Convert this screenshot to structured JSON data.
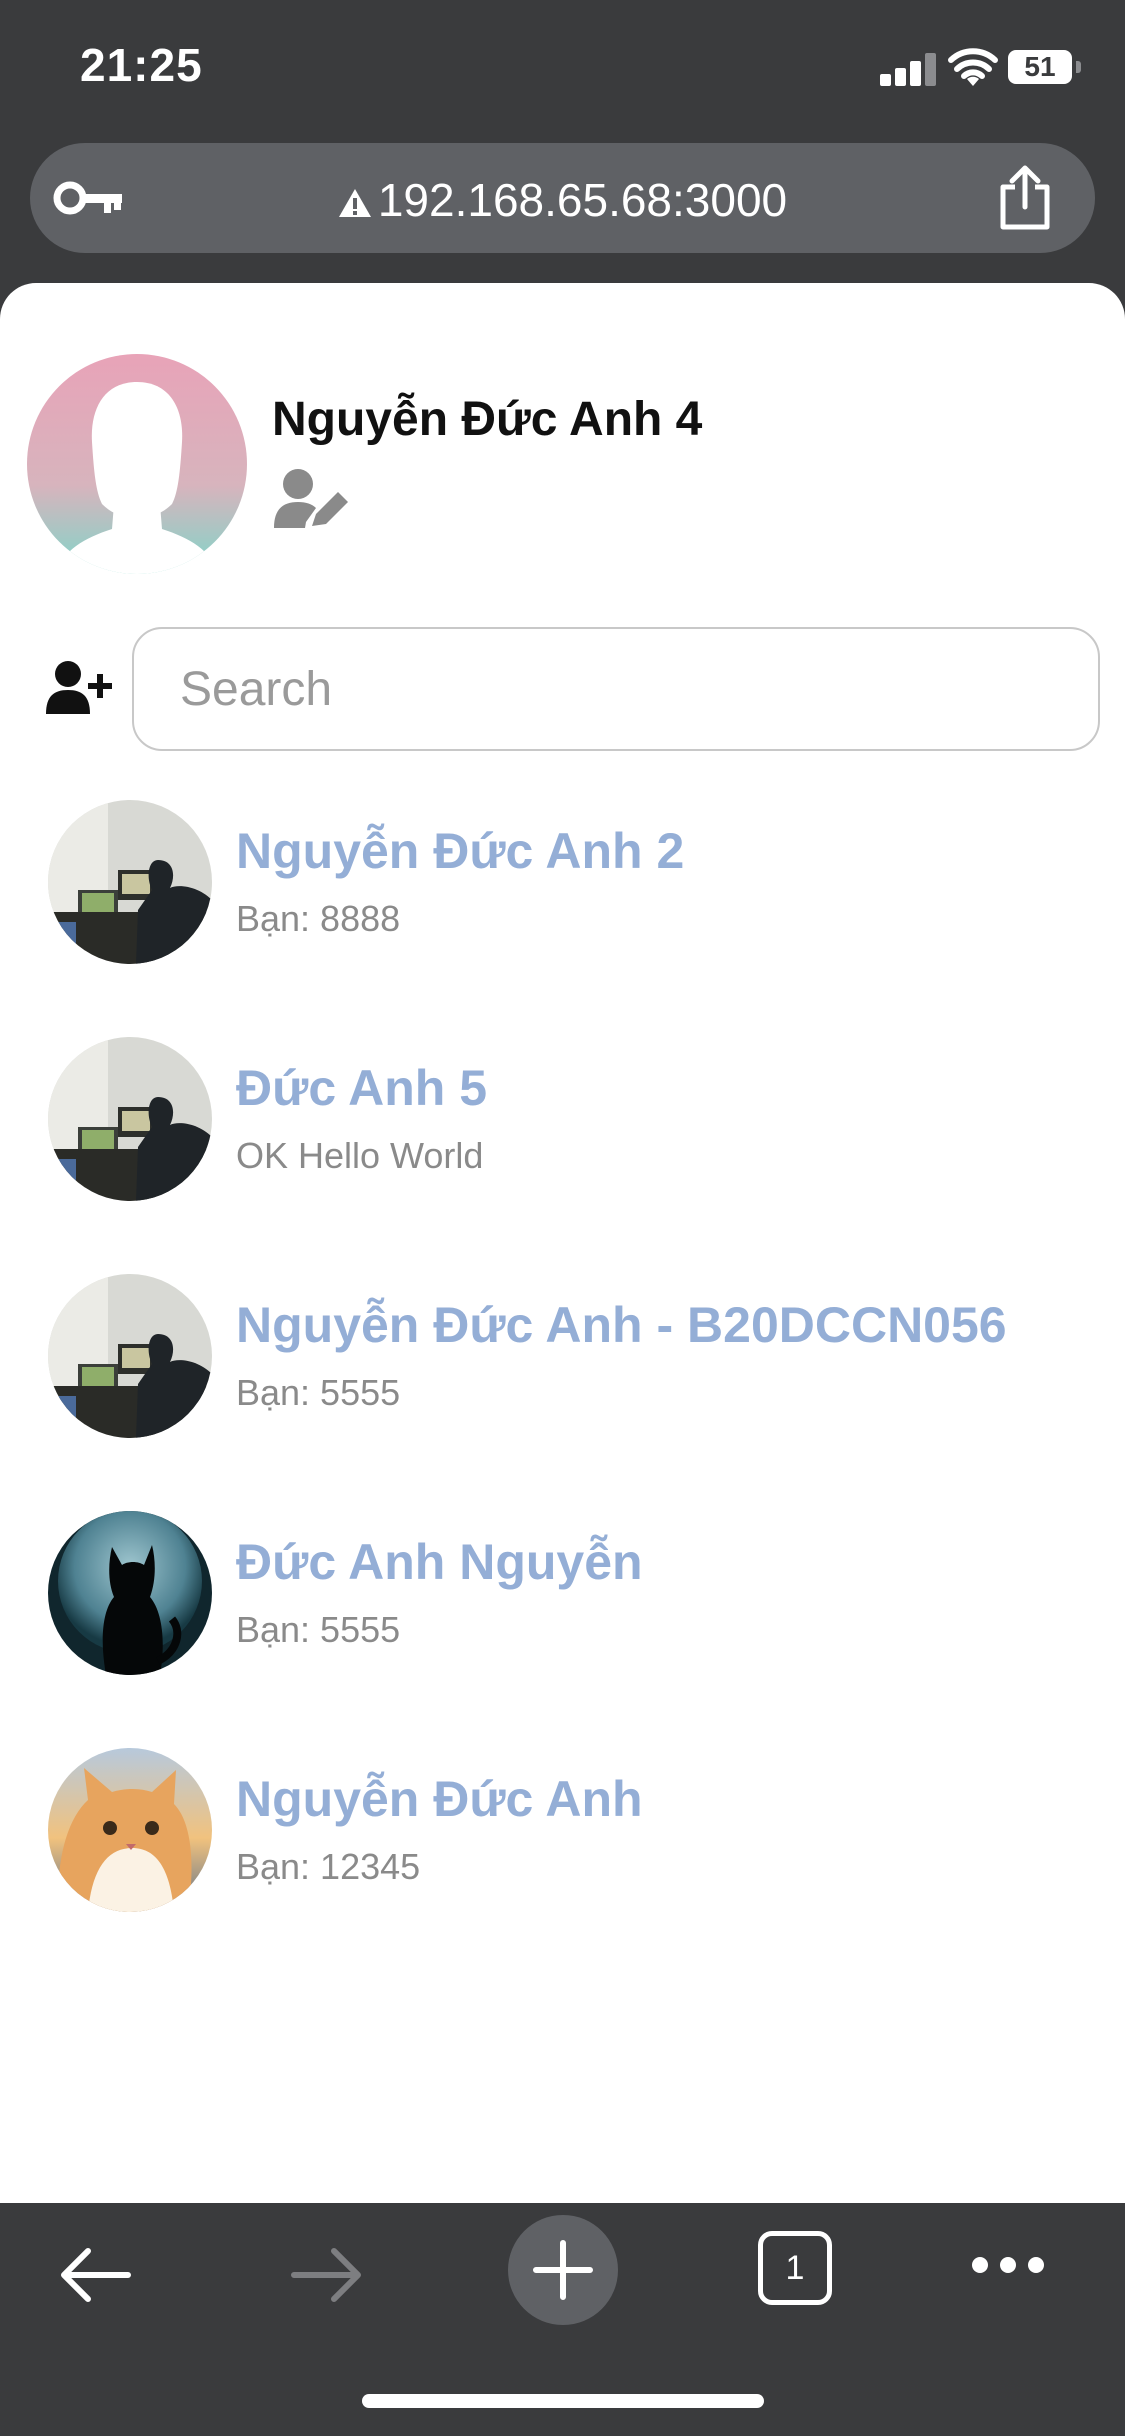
{
  "status_bar": {
    "time": "21:25",
    "battery": "51"
  },
  "browser": {
    "url": "192.168.65.68:3000",
    "tab_count": "1"
  },
  "profile": {
    "name": "Nguyễn Đức Anh 4"
  },
  "search": {
    "placeholder": "Search"
  },
  "friends": [
    {
      "name": "Nguyễn Đức Anh 2",
      "message": "Bạn: 8888",
      "avatar": "desk-photo"
    },
    {
      "name": "Đức Anh 5",
      "message": "OK Hello World",
      "avatar": "desk-photo"
    },
    {
      "name": "Nguyễn Đức Anh - B20DCCN056",
      "message": "Bạn: 5555",
      "avatar": "desk-photo"
    },
    {
      "name": "Đức Anh Nguyễn",
      "message": "Bạn: 5555",
      "avatar": "cat-moon"
    },
    {
      "name": "Nguyễn Đức Anh",
      "message": "Bạn: 12345",
      "avatar": "cat-photo"
    }
  ],
  "colors": {
    "name_accent": "#94aed6",
    "chrome": "#3a3b3d",
    "url_bar": "#5f6165"
  }
}
